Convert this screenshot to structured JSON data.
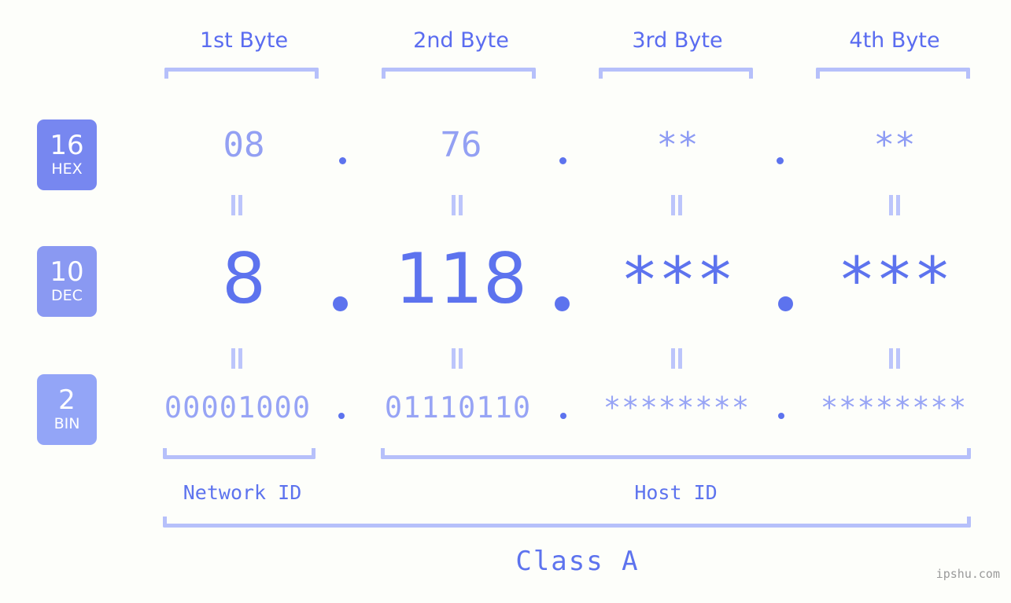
{
  "background": "#fdfefa",
  "accent": "#5d73ee",
  "accent_light": "#93a0f3",
  "bracket_color": "#b6c0fa",
  "header": {
    "byte_labels": [
      {
        "text": "1st Byte"
      },
      {
        "text": "2nd Byte"
      },
      {
        "text": "3rd Byte"
      },
      {
        "text": "4th Byte"
      }
    ]
  },
  "bases": [
    {
      "num": "16",
      "sub": "HEX",
      "color": "#7787f0"
    },
    {
      "num": "10",
      "sub": "DEC",
      "color": "#8a99f2"
    },
    {
      "num": "2",
      "sub": "BIN",
      "color": "#93a5f7"
    }
  ],
  "rows": {
    "hex": {
      "label_num": "16",
      "label_sub": "HEX",
      "values": [
        "08",
        "76",
        "**",
        "**"
      ],
      "separator": "."
    },
    "dec": {
      "label_num": "10",
      "label_sub": "DEC",
      "values": [
        "8",
        "118",
        "***",
        "***"
      ],
      "separator": "."
    },
    "bin": {
      "label_num": "2",
      "label_sub": "BIN",
      "values": [
        "00001000",
        "01110110",
        "********",
        "********"
      ],
      "separator": "."
    }
  },
  "equals_glyph": "=",
  "footer": {
    "network_id_label": "Network ID",
    "host_id_label": "Host ID",
    "class_label": "Class A"
  },
  "watermark": "ipshu.com"
}
